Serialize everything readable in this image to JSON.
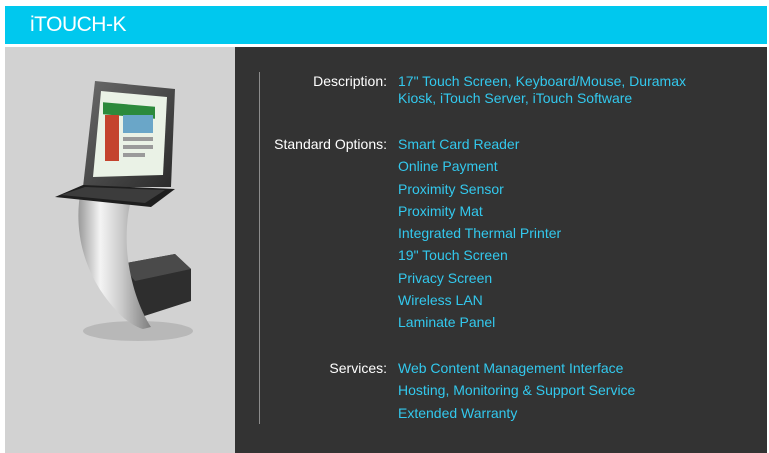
{
  "header": {
    "title": "iTOUCH-K",
    "background_color": "#00c8ee"
  },
  "product_image": {
    "icon": "touch-kiosk-illustration"
  },
  "details": {
    "description": {
      "label": "Description:",
      "lines": [
        "17\" Touch Screen, Keyboard/Mouse, Duramax",
        "Kiosk, iTouch Server, iTouch Software"
      ]
    },
    "standard_options": {
      "label": "Standard Options:",
      "items": [
        "Smart Card Reader",
        "Online Payment",
        "Proximity Sensor",
        "Proximity Mat",
        "Integrated Thermal Printer",
        "19\" Touch Screen",
        "Privacy Screen",
        "Wireless LAN",
        "Laminate Panel"
      ]
    },
    "services": {
      "label": "Services:",
      "items": [
        "Web Content Management Interface",
        "Hosting, Monitoring & Support Service",
        "Extended Warranty"
      ]
    }
  },
  "colors": {
    "panel_dark": "#333333",
    "panel_light": "#d2d2d2",
    "accent_text": "#33c9ee"
  }
}
